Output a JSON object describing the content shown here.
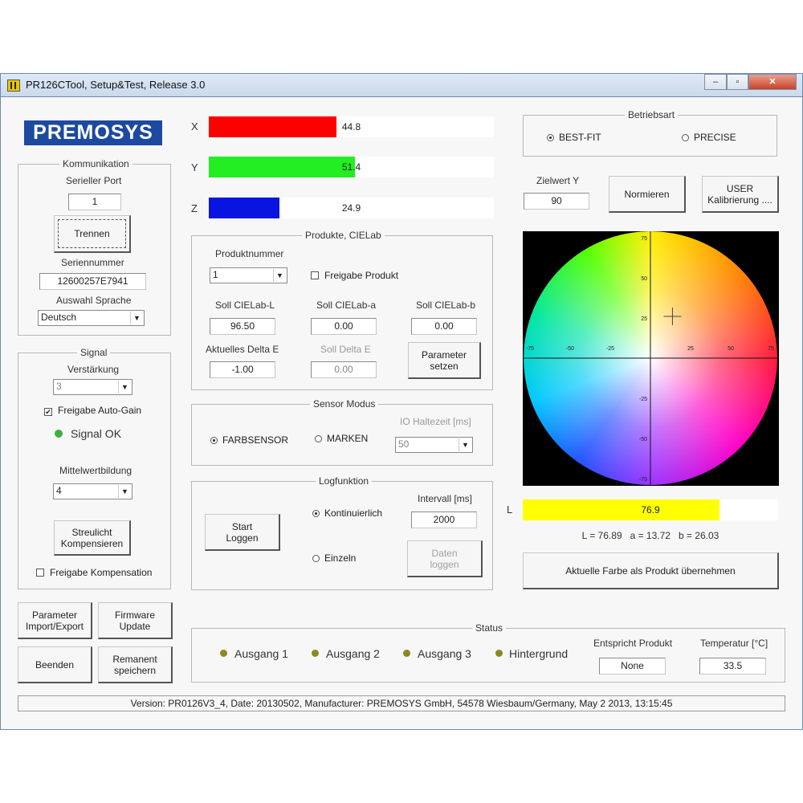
{
  "window": {
    "title": "PR126CTool, Setup&Test, Release 3.0",
    "minimize": "–",
    "maximize": "▫",
    "close": "✕"
  },
  "logo_text": "PREMOSYS",
  "kommunikation": {
    "title": "Kommunikation",
    "serial_port_label": "Serieller Port",
    "serial_port_value": "1",
    "disconnect_button": "Trennen",
    "serial_number_label": "Seriennummer",
    "serial_number_value": "12600257E7941",
    "language_label": "Auswahl Sprache",
    "language_value": "Deutsch"
  },
  "signal": {
    "title": "Signal",
    "gain_label": "Verstärkung",
    "gain_value": "3",
    "auto_gain_label": "Freigabe Auto-Gain",
    "auto_gain_checked": true,
    "signal_status": "Signal OK",
    "signal_color": "#3cb043",
    "averaging_label": "Mittelwertbildung",
    "averaging_value": "4",
    "stray_light_button_line1": "Streulicht",
    "stray_light_button_line2": "Kompensieren",
    "compensation_label": "Freigabe Kompensation",
    "compensation_checked": false
  },
  "buttons": {
    "param_import_line1": "Parameter",
    "param_import_line2": "Import/Export",
    "firmware_line1": "Firmware",
    "firmware_line2": "Update",
    "exit": "Beenden",
    "remanent_line1": "Remanent",
    "remanent_line2": "speichern"
  },
  "xyz": {
    "x": {
      "label": "X",
      "value": 44.8,
      "text": "44.8",
      "color": "#ff0000"
    },
    "y": {
      "label": "Y",
      "value": 51.4,
      "text": "51.4",
      "color": "#22ee22"
    },
    "z": {
      "label": "Z",
      "value": 24.9,
      "text": "24.9",
      "color": "#0a14e0"
    },
    "max": 100
  },
  "produkte": {
    "title": "Produkte, CIELab",
    "product_number_label": "Produktnummer",
    "product_number_value": "1",
    "release_product_label": "Freigabe Produkt",
    "release_product_checked": false,
    "target_l_label": "Soll CIELab-L",
    "target_l_value": "96.50",
    "target_a_label": "Soll CIELab-a",
    "target_a_value": "0.00",
    "target_b_label": "Soll CIELab-b",
    "target_b_value": "0.00",
    "current_delta_label": "Aktuelles Delta E",
    "current_delta_value": "-1.00",
    "target_delta_label": "Soll Delta E",
    "target_delta_value": "0.00",
    "set_params_line1": "Parameter",
    "set_params_line2": "setzen"
  },
  "sensor": {
    "title": "Sensor Modus",
    "color_sensor_label": "FARBSENSOR",
    "marks_label": "MARKEN",
    "selected": "FARBSENSOR",
    "io_hold_label": "IO Haltezeit [ms]",
    "io_hold_value": "50"
  },
  "log": {
    "title": "Logfunktion",
    "start_line1": "Start",
    "start_line2": "Loggen",
    "continuous_label": "Kontinuierlich",
    "single_label": "Einzeln",
    "selected": "Kontinuierlich",
    "interval_label": "Intervall [ms]",
    "interval_value": "2000",
    "log_data_line1": "Daten",
    "log_data_line2": "loggen"
  },
  "status": {
    "title": "Status",
    "outputs": [
      "Ausgang 1",
      "Ausgang 2",
      "Ausgang 3",
      "Hintergrund"
    ],
    "output_color": "#8a8a1e",
    "matches_label": "Entspricht Produkt",
    "matches_value": "None",
    "temperature_label": "Temperatur [°C]",
    "temperature_value": "33.5"
  },
  "betriebsart": {
    "title": "Betriebsart",
    "best_fit_label": "BEST-FIT",
    "precise_label": "PRECISE",
    "selected": "BEST-FIT"
  },
  "target_y": {
    "label": "Zielwert Y",
    "value": "90",
    "normalize_button": "Normieren",
    "user_cal_line1": "USER",
    "user_cal_line2": "Kalibrierung ...."
  },
  "lab_wheel": {
    "x_ticks_neg": [
      "-75",
      "-50",
      "-25"
    ],
    "x_ticks_pos": [
      "25",
      "50",
      "75"
    ],
    "y_ticks_pos": [
      "75",
      "50",
      "25"
    ],
    "y_ticks_neg": [
      "-25",
      "-50",
      "-75"
    ],
    "a": 13.72,
    "b": 26.03
  },
  "lightness": {
    "label": "L",
    "value": 76.9,
    "text": "76.9",
    "color": "#ffff00",
    "max": 100,
    "readout": "L = 76.89   a = 13.72   b = 26.03"
  },
  "adopt_color_button": "Aktuelle Farbe als Produkt übernehmen",
  "status_bar": "Version: PR0126V3_4, Date: 20130502, Manufacturer: PREMOSYS GmbH, 54578 Wiesbaum/Germany, May  2 2013, 13:15:45"
}
